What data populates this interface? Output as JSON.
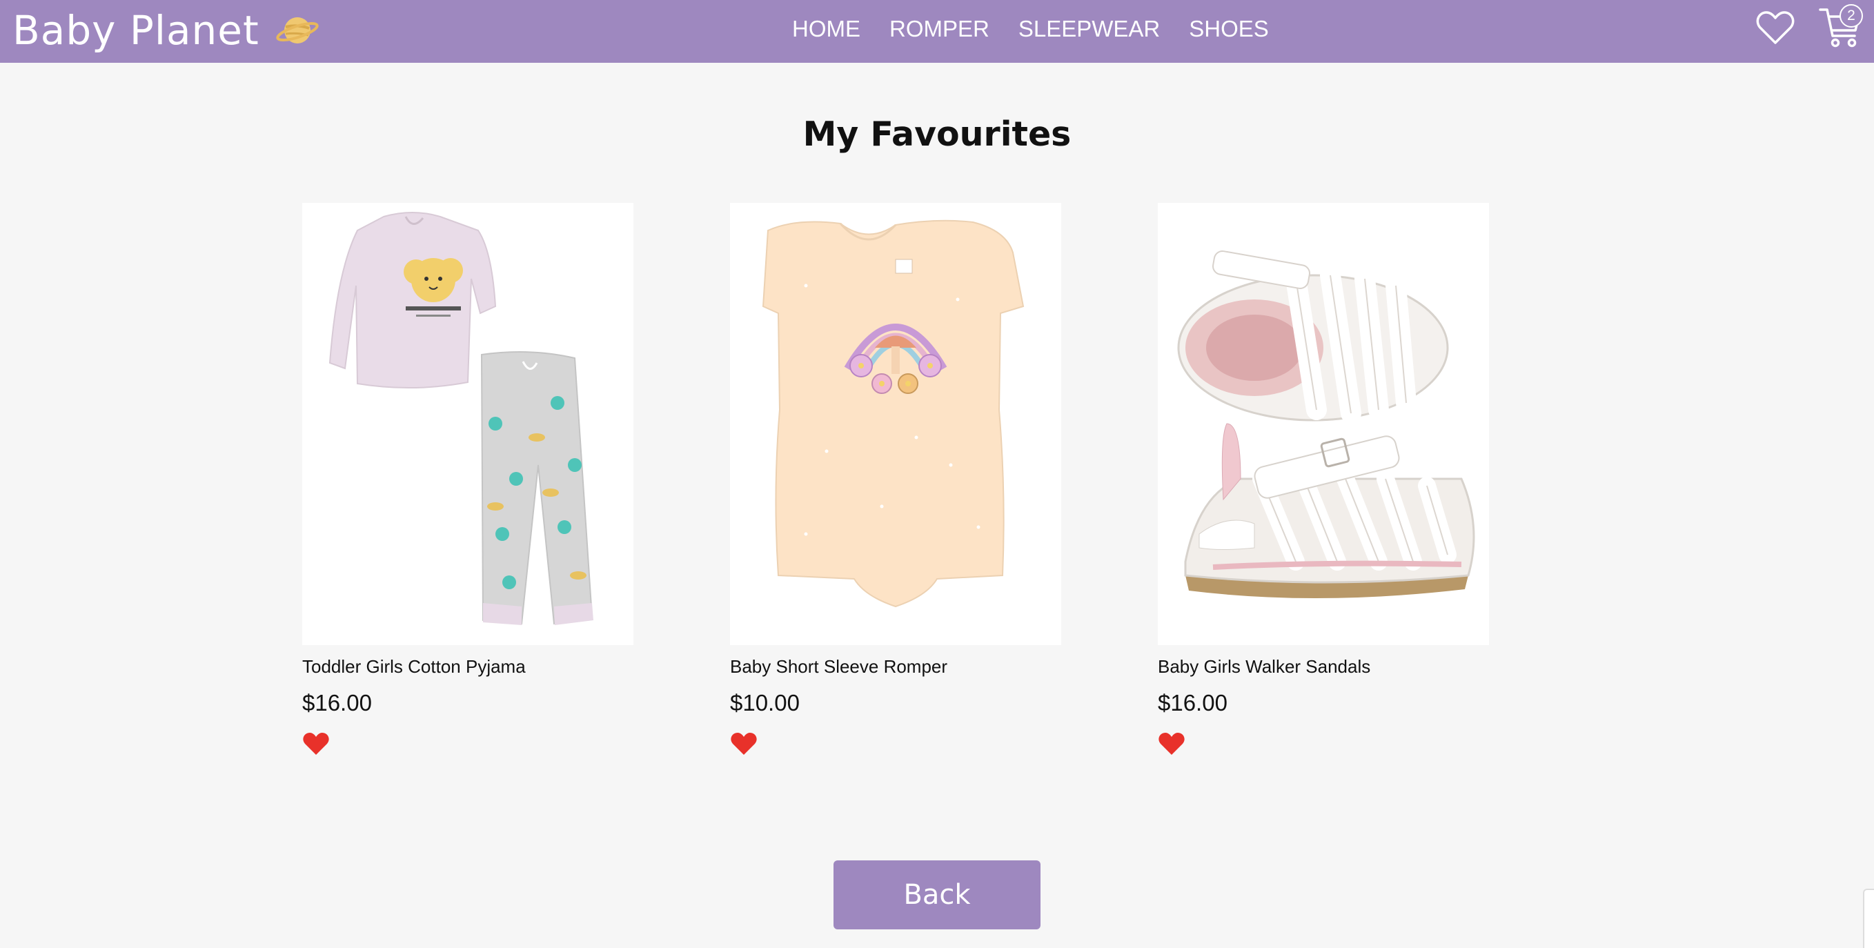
{
  "brand": {
    "name": "Baby Planet",
    "icon": "planet-icon",
    "color": "#9e88bf"
  },
  "nav": {
    "links": [
      "HOME",
      "ROMPER",
      "SLEEPWEAR",
      "SHOES"
    ],
    "favourites_icon": "heart-outline-icon",
    "cart_icon": "cart-icon",
    "cart_count": "2"
  },
  "page": {
    "title": "My Favourites"
  },
  "favourites": [
    {
      "name": "Toddler Girls Cotton Pyjama",
      "price": "$16.00",
      "image": "pyjama-image",
      "favourited": true
    },
    {
      "name": "Baby Short Sleeve Romper",
      "price": "$10.00",
      "image": "romper-image",
      "favourited": true
    },
    {
      "name": "Baby Girls Walker Sandals",
      "price": "$16.00",
      "image": "sandals-image",
      "favourited": true
    }
  ],
  "actions": {
    "back_label": "Back"
  },
  "colors": {
    "heart": "#e8312a",
    "background": "#f6f6f6"
  }
}
